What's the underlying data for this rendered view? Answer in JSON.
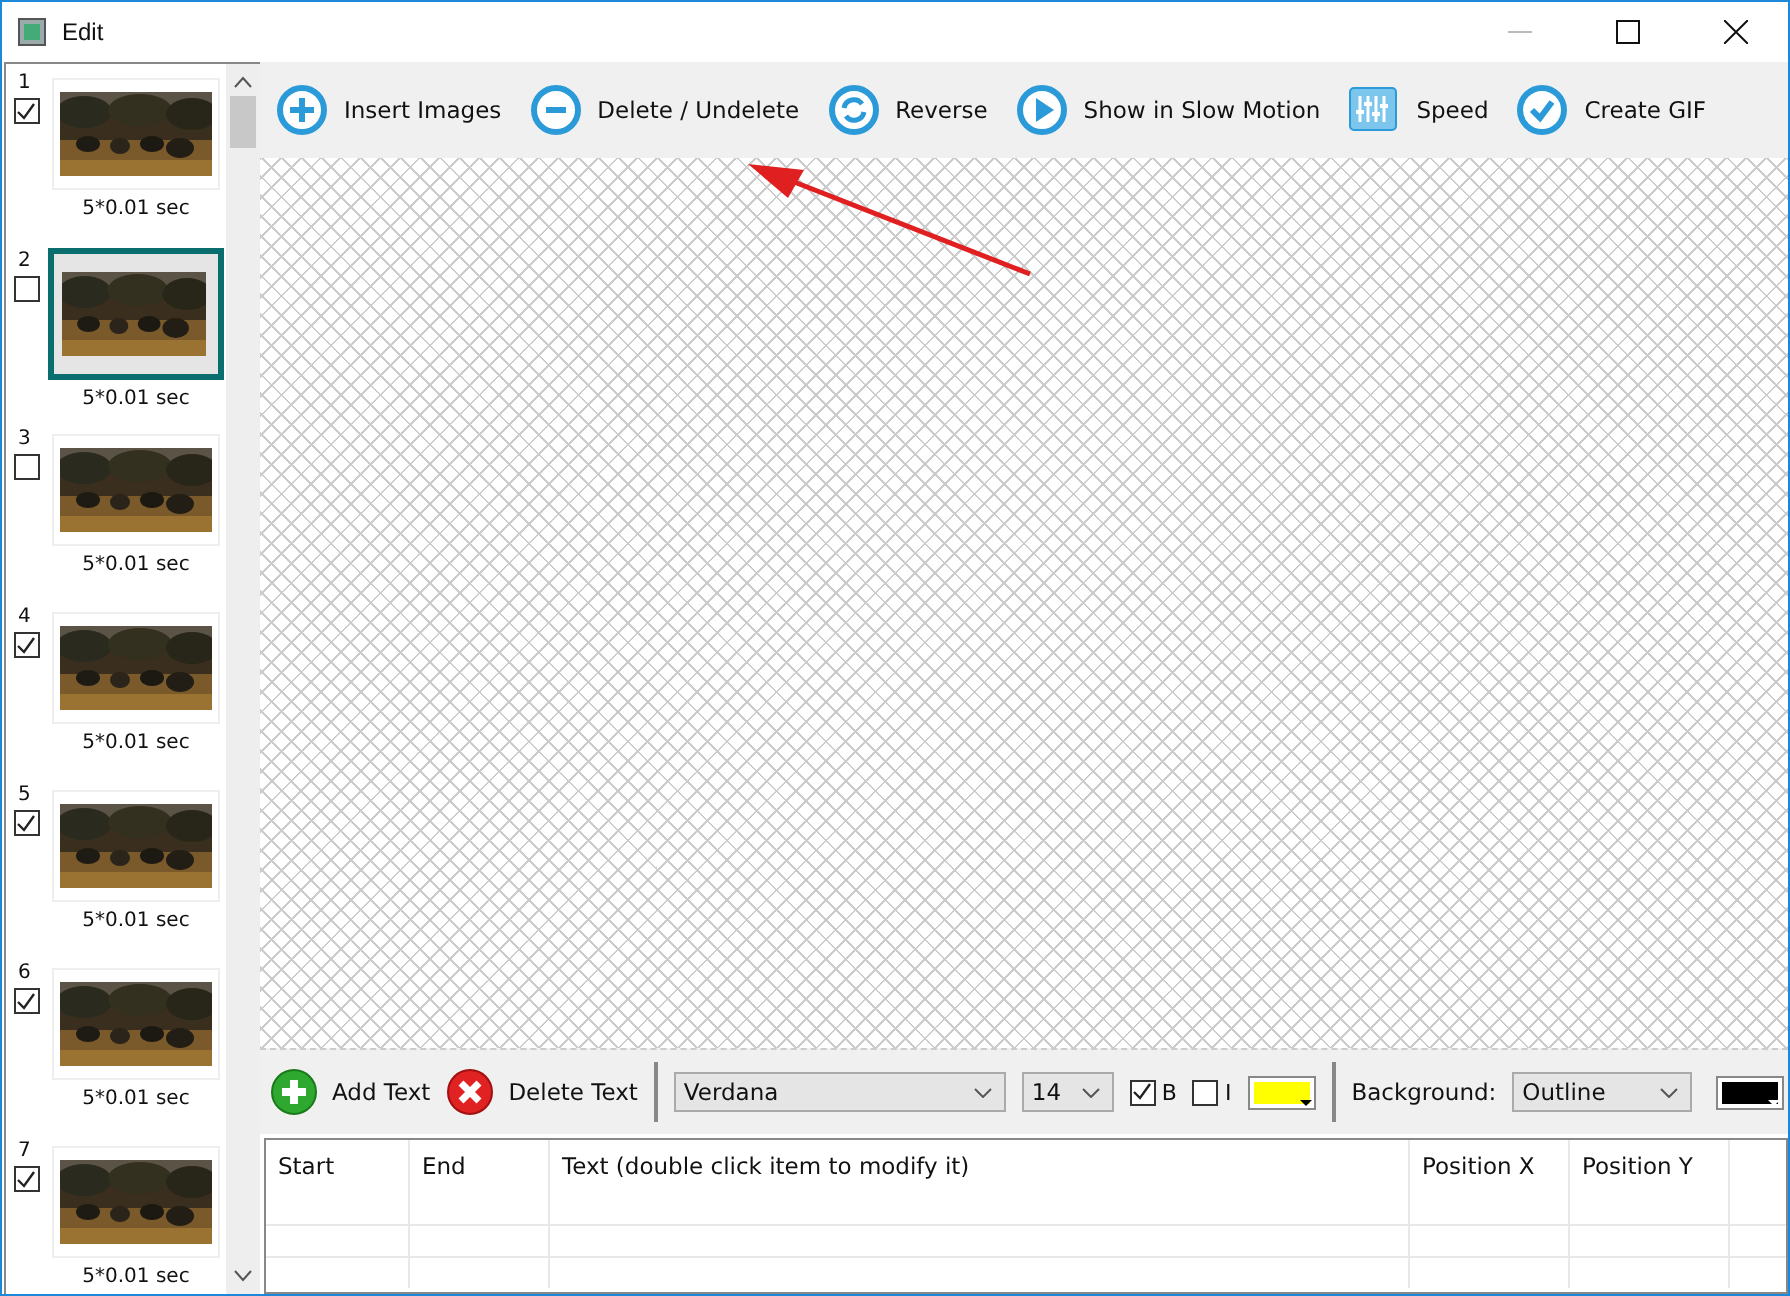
{
  "window": {
    "title": "Edit"
  },
  "frames": [
    {
      "number": "1",
      "checked": true,
      "selected": false,
      "duration": "5*0.01 sec"
    },
    {
      "number": "2",
      "checked": false,
      "selected": true,
      "duration": "5*0.01 sec"
    },
    {
      "number": "3",
      "checked": false,
      "selected": false,
      "duration": "5*0.01 sec"
    },
    {
      "number": "4",
      "checked": true,
      "selected": false,
      "duration": "5*0.01 sec"
    },
    {
      "number": "5",
      "checked": true,
      "selected": false,
      "duration": "5*0.01 sec"
    },
    {
      "number": "6",
      "checked": true,
      "selected": false,
      "duration": "5*0.01 sec"
    },
    {
      "number": "7",
      "checked": true,
      "selected": false,
      "duration": "5*0.01 sec"
    }
  ],
  "toolbar": [
    {
      "label": "Insert Images"
    },
    {
      "label": "Delete / Undelete"
    },
    {
      "label": "Reverse"
    },
    {
      "label": "Show in Slow Motion"
    },
    {
      "label": "Speed"
    },
    {
      "label": "Create GIF"
    }
  ],
  "text_toolbar": {
    "add": "Add Text",
    "delete": "Delete Text",
    "font": "Verdana",
    "size": "14",
    "bold": {
      "label": "B",
      "checked": true
    },
    "italic": {
      "label": "I",
      "checked": false
    },
    "background_label": "Background:",
    "background": "Outline"
  },
  "table": {
    "columns": [
      "Start",
      "End",
      "Text (double click item to modify it)",
      "Position X",
      "Position Y"
    ]
  }
}
